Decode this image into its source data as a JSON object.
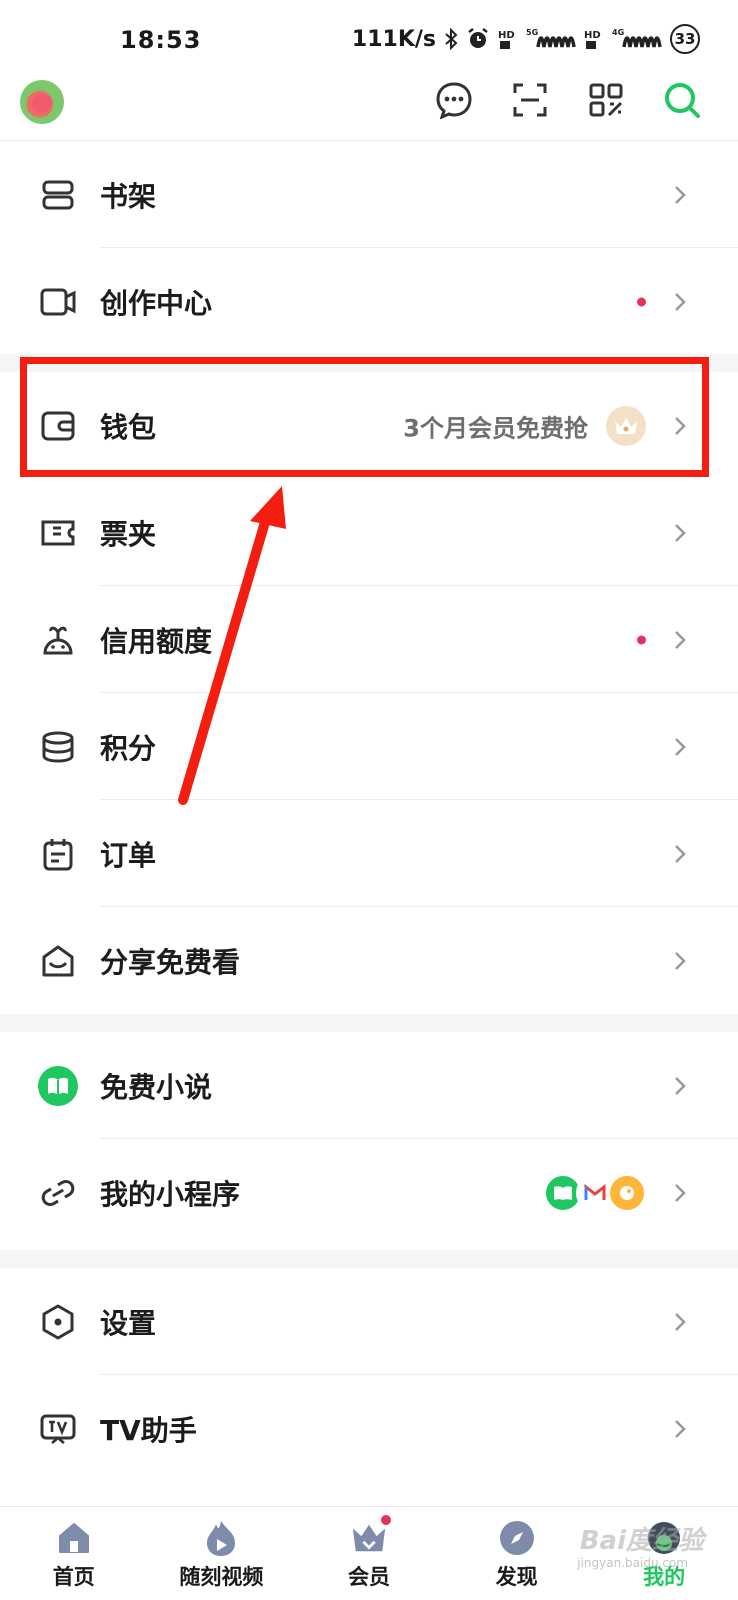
{
  "status_bar": {
    "time": "18:53",
    "net_speed": "111K/s",
    "battery": "33",
    "icons": [
      "bluetooth-icon",
      "alarm-icon",
      "hd-icon",
      "5g-signal-icon",
      "hd-icon",
      "4g-signal-icon"
    ]
  },
  "top_bar": {
    "icons": [
      "message-icon",
      "scan-icon",
      "qr-code-icon",
      "search-icon"
    ]
  },
  "sections": [
    {
      "items": [
        {
          "label": "书架",
          "icon": "bookshelf-icon"
        },
        {
          "label": "创作中心",
          "icon": "camera-icon",
          "dot": true
        }
      ]
    },
    {
      "items": [
        {
          "label": "钱包",
          "icon": "wallet-icon",
          "promo": "3个月会员免费抢"
        },
        {
          "label": "票夹",
          "icon": "ticket-icon"
        },
        {
          "label": "信用额度",
          "icon": "credit-icon",
          "dot": true
        },
        {
          "label": "积分",
          "icon": "coins-icon"
        },
        {
          "label": "订单",
          "icon": "order-icon"
        },
        {
          "label": "分享免费看",
          "icon": "share-icon"
        }
      ]
    },
    {
      "items": [
        {
          "label": "免费小说",
          "icon": "book-icon"
        },
        {
          "label": "我的小程序",
          "icon": "link-icon"
        }
      ]
    },
    {
      "items": [
        {
          "label": "设置",
          "icon": "settings-icon"
        },
        {
          "label": "TV助手",
          "icon": "tv-icon"
        }
      ]
    }
  ],
  "bottom_nav": [
    {
      "label": "首页",
      "icon": "home-icon"
    },
    {
      "label": "随刻视频",
      "icon": "flame-play-icon"
    },
    {
      "label": "会员",
      "icon": "vip-crown-icon",
      "badge": true
    },
    {
      "label": "发现",
      "icon": "compass-icon"
    },
    {
      "label": "我的",
      "icon": "profile-icon",
      "active": true
    }
  ],
  "watermark": {
    "text": "Bai度经验",
    "sub": "jingyan.baidu.com"
  },
  "colors": {
    "accent": "#1ec760",
    "highlight": "#f41e10",
    "dot": "#e5325d"
  }
}
